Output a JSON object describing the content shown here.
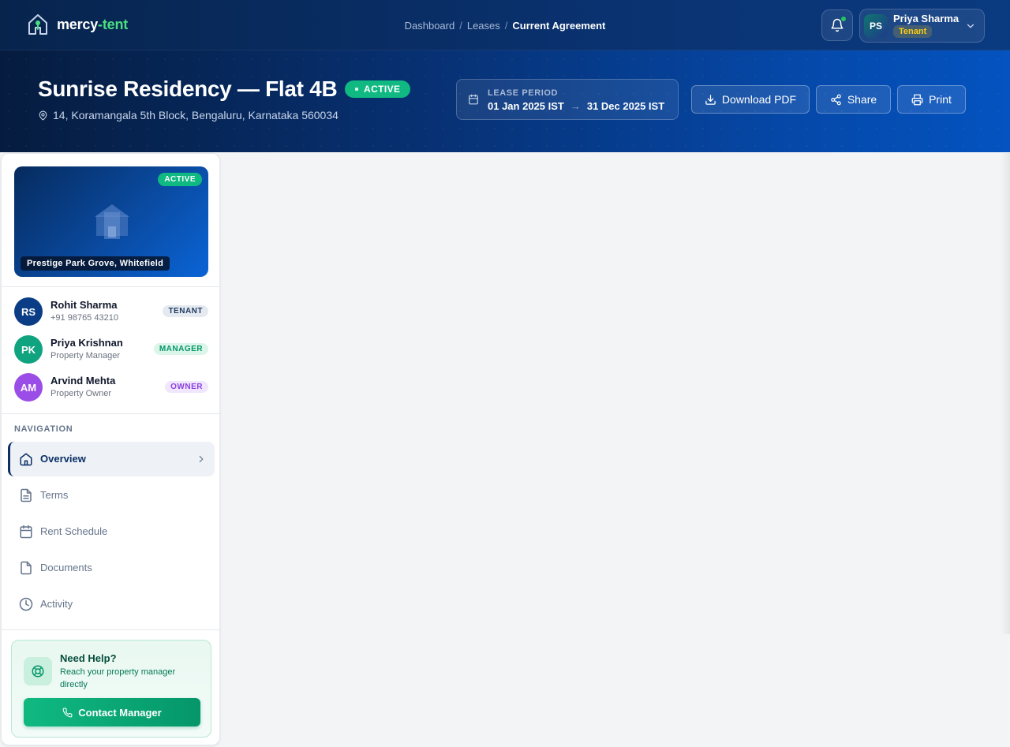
{
  "brand": {
    "name_main": "mercy",
    "name_accent": "-tent",
    "logo_icon": "house-pin-icon"
  },
  "breadcrumb": [
    "Dashboard",
    "Leases",
    "Current Agreement"
  ],
  "user": {
    "initials": "PS",
    "name": "Priya Sharma",
    "role": "Tenant"
  },
  "hero": {
    "title": "Sunrise Residency — Flat 4B",
    "status": "ACTIVE",
    "address": "14, Koramangala 5th Block, Bengaluru, Karnataka 560034",
    "lease_label": "LEASE PERIOD",
    "lease_start": "01 Jan 2025 IST",
    "lease_arrow": "→",
    "lease_end": "31 Dec 2025 IST",
    "actions": [
      {
        "label": "Download PDF",
        "icon": "download-icon"
      },
      {
        "label": "Share",
        "icon": "share-icon"
      },
      {
        "label": "Print",
        "icon": "printer-icon"
      }
    ]
  },
  "property": {
    "status": "ACTIVE",
    "name": "Prestige Park Grove, Whitefield"
  },
  "people": [
    {
      "initials": "RS",
      "name": "Rohit Sharma",
      "sub": "+91 98765 43210",
      "tag": "TENANT",
      "avatar_color": "#0b3d86",
      "tag_bg": "#e5eaf1",
      "tag_color": "#1e3a5f"
    },
    {
      "initials": "PK",
      "name": "Priya Krishnan",
      "sub": "Property Manager",
      "tag": "MANAGER",
      "avatar_color": "#10a37f",
      "tag_bg": "#dcf5ea",
      "tag_color": "#059669"
    },
    {
      "initials": "AM",
      "name": "Arvind Mehta",
      "sub": "Property Owner",
      "tag": "OWNER",
      "avatar_color": "#9b4de8",
      "tag_bg": "#f0e6fd",
      "tag_color": "#8b3fe0"
    }
  ],
  "navigation": {
    "label": "NAVIGATION",
    "items": [
      {
        "label": "Overview",
        "icon": "home-icon",
        "active": true
      },
      {
        "label": "Terms",
        "icon": "file-text-icon",
        "active": false
      },
      {
        "label": "Rent Schedule",
        "icon": "calendar-icon",
        "active": false
      },
      {
        "label": "Documents",
        "icon": "file-icon",
        "active": false
      },
      {
        "label": "Activity",
        "icon": "clock-icon",
        "active": false
      }
    ]
  },
  "help": {
    "title": "Need Help?",
    "subtitle": "Reach your property manager directly",
    "button": "Contact Manager",
    "icon": "lifebuoy-icon",
    "button_icon": "phone-icon"
  },
  "colors": {
    "brand_accent": "#4ade80",
    "active_green": "#10b981",
    "nav_active": "#0b2f66"
  }
}
